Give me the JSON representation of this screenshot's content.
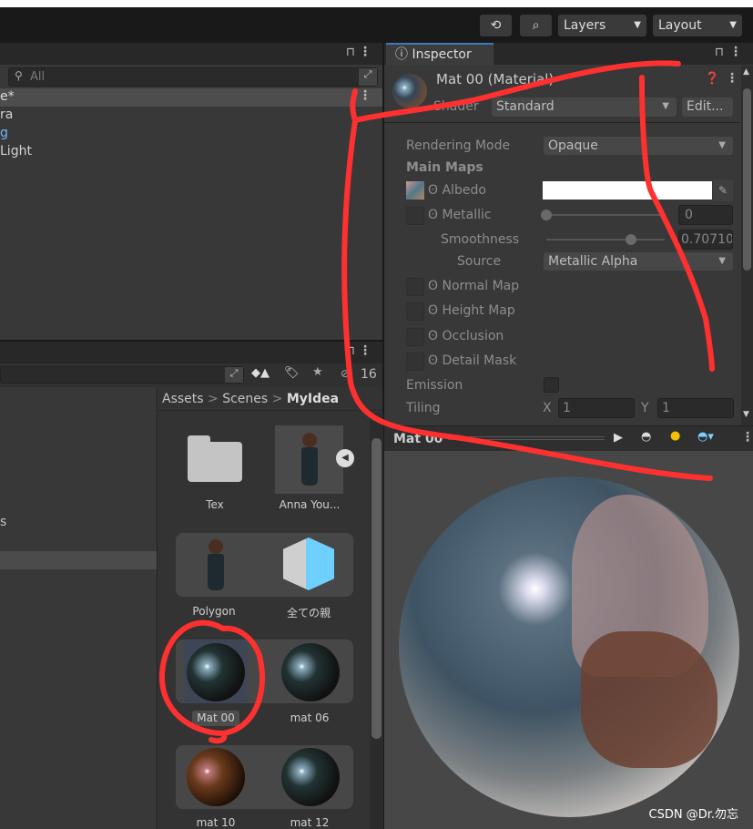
{
  "toolbar": {
    "history_icon": "history-icon",
    "search_icon": "search-icon",
    "layers": "Layers",
    "layout": "Layout"
  },
  "hierarchy": {
    "search_placeholder": "All",
    "scene": "e*",
    "items": [
      "ra",
      "g",
      "Light"
    ],
    "item_colors": [
      "#d2d2d2",
      "#7ab4ff",
      "#d2d2d2"
    ]
  },
  "project": {
    "filter_count": "16",
    "breadcrumb": [
      "Assets",
      "Scenes",
      "MyIdea"
    ],
    "tree_items": [
      "s"
    ],
    "assets": [
      {
        "label": "Tex",
        "type": "folder"
      },
      {
        "label": "Anna You...",
        "type": "model"
      },
      {
        "label": "Polygon",
        "type": "model"
      },
      {
        "label": "全ての親",
        "type": "prefab"
      },
      {
        "label": "Mat 00",
        "type": "material",
        "selected": true
      },
      {
        "label": "mat 06",
        "type": "material"
      },
      {
        "label": "mat 10",
        "type": "material"
      },
      {
        "label": "mat 12",
        "type": "material"
      }
    ]
  },
  "inspector": {
    "tab": "Inspector",
    "title": "Mat 00 (Material)",
    "shader_label": "Shader",
    "shader": "Standard",
    "edit": "Edit...",
    "rendering_mode_label": "Rendering Mode",
    "rendering_mode": "Opaque",
    "main_maps": "Main Maps",
    "albedo": "Albedo",
    "albedo_color": "#ffffff",
    "metallic": "Metallic",
    "metallic_value": "0",
    "smoothness": "Smoothness",
    "smoothness_value": "0.70710",
    "source_label": "Source",
    "source": "Metallic Alpha",
    "normal_map": "Normal Map",
    "height_map": "Height Map",
    "occlusion": "Occlusion",
    "detail_mask": "Detail Mask",
    "emission": "Emission",
    "tiling": "Tiling",
    "x_label": "X",
    "x_value": "1",
    "y_label": "Y",
    "y_value": "1"
  },
  "preview": {
    "title": "Mat 00"
  },
  "watermark": "CSDN @Dr.勿忘",
  "colors": {
    "accent": "#3a79bb",
    "annotation": "#ff3030"
  }
}
